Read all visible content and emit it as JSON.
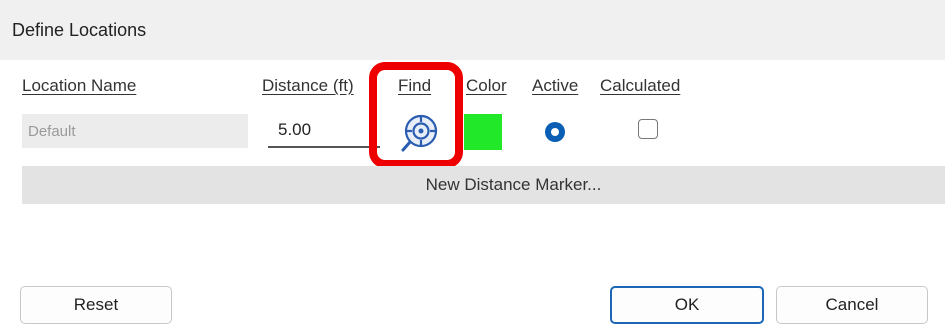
{
  "dialog": {
    "title": "Define Locations"
  },
  "columns": {
    "location_name": "Location Name",
    "distance": "Distance (ft)",
    "find": "Find",
    "color": "Color",
    "active": "Active",
    "calculated": "Calculated"
  },
  "row": {
    "location_name": "Default",
    "distance": "5.00",
    "color": "#22e82a",
    "active": true,
    "calculated": false,
    "find_icon": "locate-crosshair-icon"
  },
  "actions": {
    "new_marker": "New Distance Marker...",
    "reset": "Reset",
    "ok": "OK",
    "cancel": "Cancel"
  },
  "annotation": {
    "highlight_color": "#ee0000"
  }
}
